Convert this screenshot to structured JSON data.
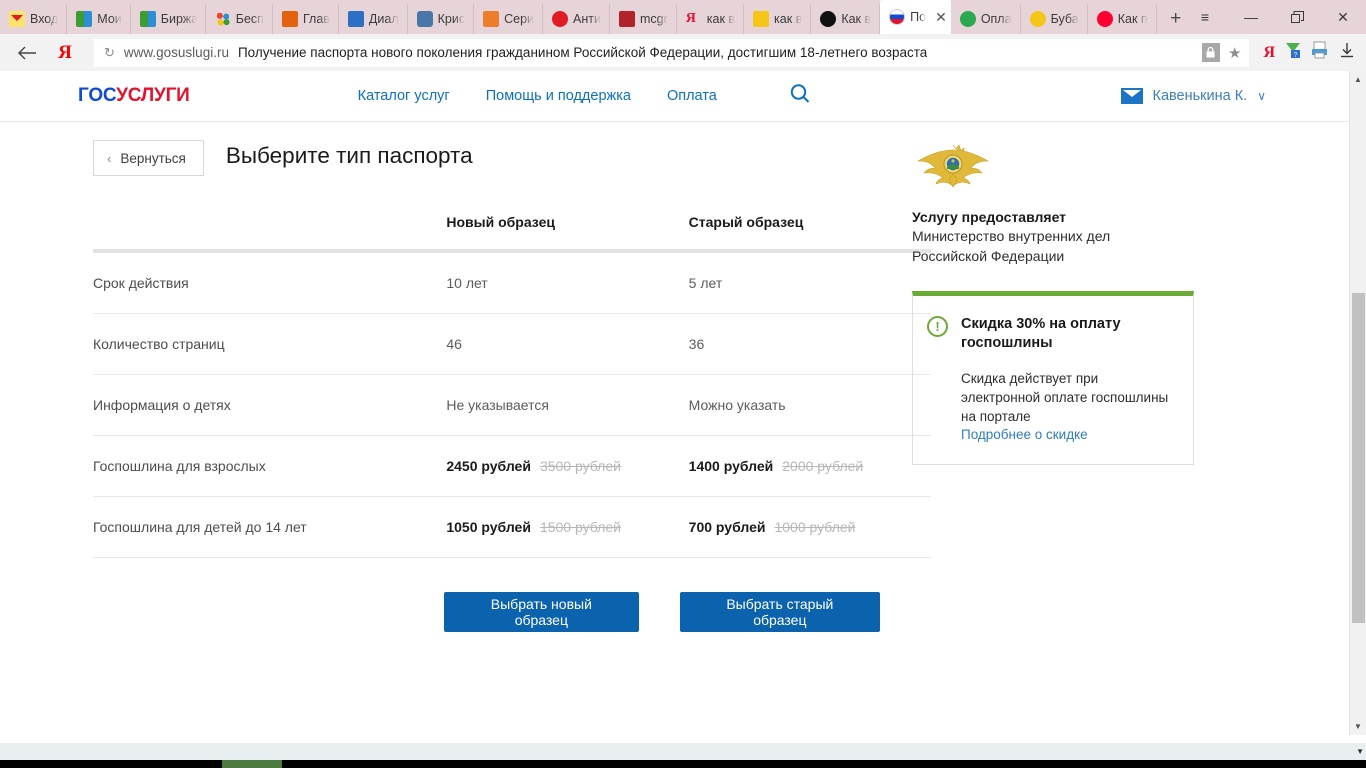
{
  "browser": {
    "tabs": [
      {
        "label": "Вход",
        "icon": "mail-envelope-icon",
        "color": "#f7c948",
        "active": false
      },
      {
        "label": "Мои",
        "icon": "bars-icon",
        "color": "#3f9c35",
        "active": false
      },
      {
        "label": "Биржа",
        "icon": "bars-icon",
        "color": "#3f9c35",
        "active": false
      },
      {
        "label": "Бесп",
        "icon": "dots-icon",
        "color": "#2b8fd6",
        "active": false
      },
      {
        "label": "Глав",
        "icon": "orange-square-icon",
        "color": "#e2620d",
        "active": false
      },
      {
        "label": "Диал",
        "icon": "chat-icon",
        "color": "#2b70c4",
        "active": false
      },
      {
        "label": "Крис",
        "icon": "vk-icon",
        "color": "#4a76a8",
        "active": false
      },
      {
        "label": "Сери",
        "icon": "fox-icon",
        "color": "#ed7d2b",
        "active": false
      },
      {
        "label": "Анти",
        "icon": "copyright-icon",
        "color": "#e01b24",
        "active": false
      },
      {
        "label": "mcgr",
        "icon": "bookmark-icon",
        "color": "#b0232a",
        "active": false
      },
      {
        "label": "как в",
        "icon": "yandex-icon",
        "color": "#e8112d",
        "active": false
      },
      {
        "label": "как в",
        "icon": "photo-icon",
        "color": "#f5c518",
        "active": false
      },
      {
        "label": "Как в",
        "icon": "black-circle-icon",
        "color": "#111111",
        "active": false
      },
      {
        "label": "По",
        "icon": "russia-flag-icon",
        "color": "#ffffff",
        "active": true
      },
      {
        "label": "Опла",
        "icon": "globe-icon",
        "color": "#2aa94d",
        "active": false
      },
      {
        "label": "Буба",
        "icon": "play-yellow-icon",
        "color": "#f5c518",
        "active": false
      },
      {
        "label": "Как п",
        "icon": "youtube-icon",
        "color": "#ff0033",
        "active": false
      }
    ],
    "new_tab_label": "+",
    "window_controls": {
      "menu": "≡",
      "minimize": "—",
      "restore": "❐",
      "close": "✕"
    },
    "back_arrow": "←",
    "yandex_mark": "Я",
    "reload_icon": "↻",
    "url_domain": "www.gosuslugi.ru",
    "page_title": "Получение паспорта нового поколения гражданином Российской Федерации, достигшим 18-летнего возраста",
    "lock_icon": "🔒",
    "star_icon": "★",
    "extension_icons": [
      "yandex-ext-icon",
      "download-helper-icon",
      "print-icon",
      "downloads-icon"
    ]
  },
  "site": {
    "logo_part1": "ГОС",
    "logo_part2": "УСЛУГИ",
    "nav": [
      {
        "label": "Каталог услуг"
      },
      {
        "label": "Помощь и поддержка"
      },
      {
        "label": "Оплата"
      }
    ],
    "search_icon": "search-icon",
    "user_name": "Кавенькина К.",
    "user_caret": "∨",
    "mail_icon": "envelope-icon"
  },
  "main": {
    "back_button": "Вернуться",
    "back_chevron": "‹",
    "title": "Выберите тип паспорта",
    "table": {
      "columns": [
        "",
        "Новый образец",
        "Старый образец"
      ],
      "rows": [
        {
          "label": "Срок действия",
          "new": {
            "value": "10 лет",
            "old": ""
          },
          "old_type": {
            "value": "5 лет",
            "old": ""
          }
        },
        {
          "label": "Количество страниц",
          "new": {
            "value": "46",
            "old": ""
          },
          "old_type": {
            "value": "36",
            "old": ""
          }
        },
        {
          "label": "Информация о детях",
          "new": {
            "value": "Не указывается",
            "old": ""
          },
          "old_type": {
            "value": "Можно указать",
            "old": ""
          }
        },
        {
          "label": "Госпошлина для взрослых",
          "new": {
            "value": "2450 рублей",
            "old": "3500 рублей"
          },
          "old_type": {
            "value": "1400 рублей",
            "old": "2000 рублей"
          }
        },
        {
          "label": "Госпошлина для детей до 14 лет",
          "new": {
            "value": "1050 рублей",
            "old": "1500 рублей"
          },
          "old_type": {
            "value": "700 рублей",
            "old": "1000 рублей"
          }
        }
      ]
    },
    "buttons": {
      "choose_new": "Выбрать новый образец",
      "choose_old": "Выбрать старый образец"
    }
  },
  "sidebar": {
    "emblem": "mvd-emblem-icon",
    "provider_label": "Услугу предоставляет",
    "provider_name": "Министерство внутренних дел\nРоссийской Федерации",
    "provider_name_line1": "Министерство внутренних дел",
    "provider_name_line2": "Российской Федерации",
    "promo": {
      "icon": "exclamation-circle-icon",
      "icon_glyph": "!",
      "title": "Скидка 30% на оплату госпошлины",
      "text": "Скидка действует при электронной оплате госпошлины на портале",
      "link": "Подробнее о скидке",
      "accent_color": "#6aab34"
    }
  },
  "colors": {
    "brand_blue": "#0d4cd3",
    "brand_red": "#e4122b",
    "link_blue": "#0d6fc4",
    "button_blue": "#0b63ad",
    "promo_green": "#6aab34",
    "tabstrip_bg": "#e6d4d8"
  }
}
